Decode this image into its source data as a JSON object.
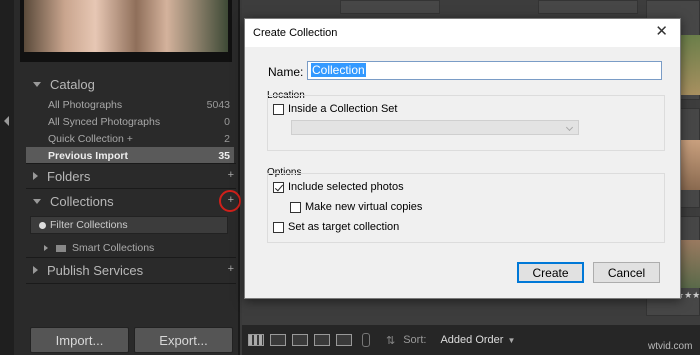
{
  "left_panel": {
    "catalog": {
      "title": "Catalog",
      "items": [
        {
          "label": "All Photographs",
          "count": "5043"
        },
        {
          "label": "All Synced Photographs",
          "count": "0"
        },
        {
          "label": "Quick Collection +",
          "count": "2"
        },
        {
          "label": "Previous Import",
          "count": "35"
        }
      ]
    },
    "folders": {
      "title": "Folders"
    },
    "collections": {
      "title": "Collections",
      "filter_label": "Filter Collections",
      "smart_collections_label": "Smart Collections"
    },
    "publish_services": {
      "title": "Publish Services"
    },
    "plus_glyph": "+",
    "import_label": "Import...",
    "export_label": "Export..."
  },
  "toolbar": {
    "sort_label": "Sort:",
    "sort_value": "Added Order"
  },
  "dialog": {
    "title": "Create Collection",
    "close_glyph": "✕",
    "name_label": "Name:",
    "name_value": "Collection",
    "location_group": "Location",
    "inside_set_label": "Inside a Collection Set",
    "inside_set_checked": false,
    "options_group": "Options",
    "include_selected_label": "Include selected photos",
    "include_selected_checked": true,
    "virtual_copies_label": "Make new virtual copies",
    "virtual_copies_checked": false,
    "target_collection_label": "Set as target collection",
    "target_collection_checked": false,
    "create_label": "Create",
    "cancel_label": "Cancel"
  },
  "grid": {
    "stars": "★★★"
  },
  "watermark": "wtvid.com",
  "colors": {
    "highlight_circle": "#d0201a",
    "selection_blue": "#3399ff",
    "button_focus": "#0078d7"
  }
}
